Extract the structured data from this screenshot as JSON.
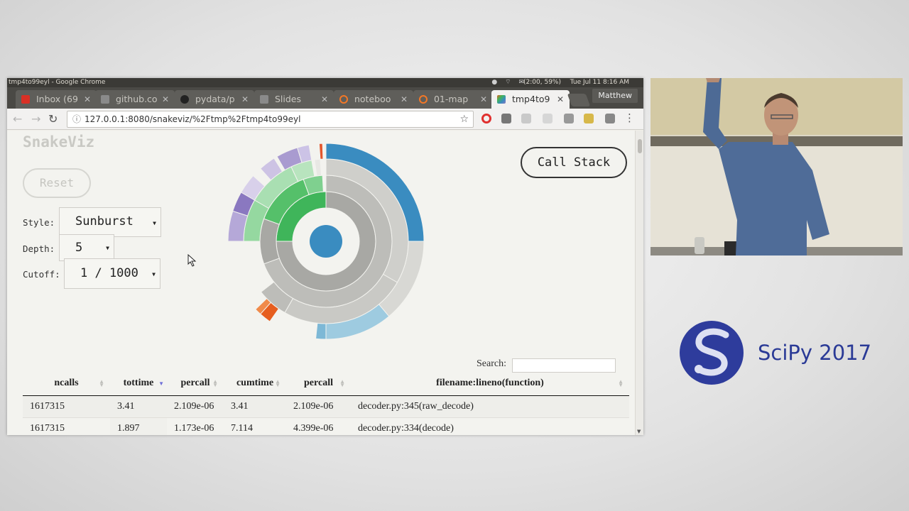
{
  "os_bar": {
    "window_title": "tmp4to99eyl - Google Chrome",
    "battery": "(2:00, 59%)",
    "clock": "Tue Jul 11  8:16 AM"
  },
  "browser": {
    "tabs": [
      {
        "label": "Inbox (69",
        "icon": "gmail-icon",
        "color": "#d93025",
        "active": false
      },
      {
        "label": "github.co",
        "icon": "page-icon",
        "color": "#8a8a8a",
        "active": false
      },
      {
        "label": "pydata/p",
        "icon": "github-icon",
        "color": "#222222",
        "active": false
      },
      {
        "label": "Slides",
        "icon": "page-icon",
        "color": "#8a8a8a",
        "active": false
      },
      {
        "label": "noteboo",
        "icon": "jupyter-icon",
        "color": "#f37726",
        "active": false
      },
      {
        "label": "01-map",
        "icon": "jupyter-icon",
        "color": "#f37726",
        "active": false
      },
      {
        "label": "tmp4to9",
        "icon": "snakeviz-icon",
        "color": "#7a5ab5",
        "active": true
      }
    ],
    "profile": "Matthew",
    "url": "127.0.0.1:8080/snakeviz/%2Ftmp%2Ftmp4to99eyl"
  },
  "app": {
    "title": "SnakeViz",
    "reset_label": "Reset",
    "style_label": "Style:",
    "style_value": "Sunburst",
    "depth_label": "Depth:",
    "depth_value": "5",
    "cutoff_label": "Cutoff:",
    "cutoff_value": "1 / 1000",
    "callstack_label": "Call Stack",
    "search_label": "Search:",
    "search_value": ""
  },
  "table": {
    "columns": [
      "ncalls",
      "tottime",
      "percall",
      "cumtime",
      "percall",
      "filename:lineno(function)"
    ],
    "sorted_column": "tottime",
    "rows": [
      [
        "1617315",
        "3.41",
        "2.109e-06",
        "3.41",
        "2.109e-06",
        "decoder.py:345(raw_decode)"
      ],
      [
        "1617315",
        "1.897",
        "1.173e-06",
        "7.114",
        "4.399e-06",
        "decoder.py:334(decode)"
      ]
    ]
  },
  "colors": {
    "blue": "#3a8cc0",
    "green": "#3fb55a",
    "purple": "#8a78c0",
    "orange": "#e65e1f",
    "gray": "#b5b5b0"
  },
  "branding": {
    "conference": "SciPy 2017"
  }
}
